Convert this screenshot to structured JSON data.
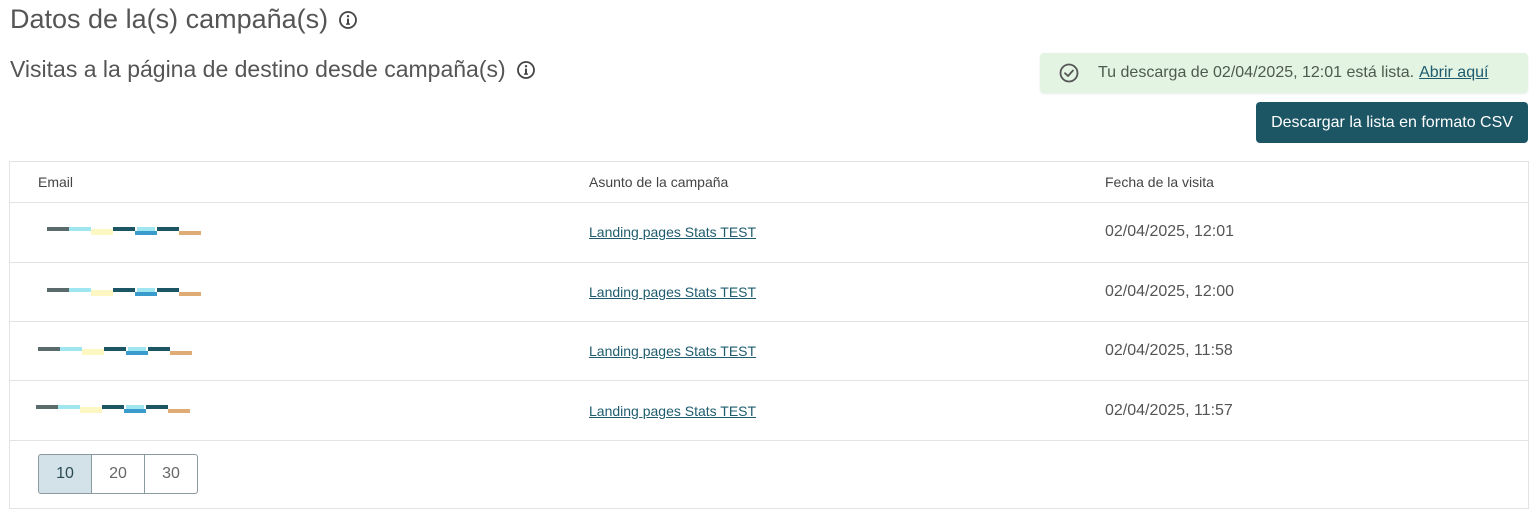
{
  "page": {
    "title": "Datos de la(s) campaña(s)",
    "subtitle": "Visitas a la página de destino desde campaña(s)"
  },
  "toast": {
    "message": "Tu descarga de 02/04/2025, 12:01 está lista.",
    "link": "Abrir aquí",
    "icon": "check-circle-icon"
  },
  "actions": {
    "csv_button": "Descargar la lista en formato CSV"
  },
  "table": {
    "headers": {
      "email": "Email",
      "subject": "Asunto de la campaña",
      "date": "Fecha de la visita"
    },
    "rows": [
      {
        "subject": "Landing pages Stats TEST",
        "date": "02/04/2025, 12:01"
      },
      {
        "subject": "Landing pages Stats TEST",
        "date": "02/04/2025, 12:00"
      },
      {
        "subject": "Landing pages Stats TEST",
        "date": "02/04/2025, 11:58"
      },
      {
        "subject": "Landing pages Stats TEST",
        "date": "02/04/2025, 11:57"
      }
    ]
  },
  "pagination": {
    "options": [
      "10",
      "20",
      "30"
    ],
    "selected": "10"
  },
  "colors": {
    "primary": "#1c5564",
    "link": "#1e5c6e",
    "toast_bg": "#e3f4e3",
    "email_redaction": [
      "#5b6b6b",
      "#9fe6f0",
      "#fdf7c4",
      "#1c5564",
      "#3a9ccc",
      "#e0ac76"
    ]
  }
}
